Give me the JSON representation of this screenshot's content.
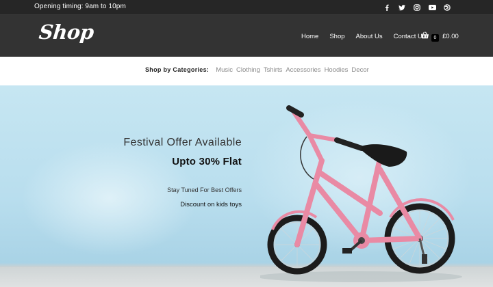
{
  "topbar": {
    "timing": "Opening timing: 9am to 10pm",
    "social": [
      "facebook-icon",
      "twitter-icon",
      "instagram-icon",
      "youtube-icon",
      "dribbble-icon"
    ]
  },
  "header": {
    "logo": "Shop",
    "nav": [
      "Home",
      "Shop",
      "About Us",
      "Contact Us"
    ],
    "cart": {
      "count": "0",
      "total": "£0.00"
    }
  },
  "categories": {
    "title": "Shop by Categories:",
    "items": [
      "Music",
      "Clothing",
      "Tshirts",
      "Accessories",
      "Hoodies",
      "Decor"
    ]
  },
  "hero": {
    "offer": "Festival Offer Available",
    "flat": "Upto 30% Flat",
    "stay": "Stay Tuned For Best Offers",
    "discount": "Discount on kids toys"
  },
  "colors": {
    "topbar": "#262626",
    "header": "#333333",
    "hero_bg": "#bfe2ef",
    "bike_frame": "#e98aa4"
  }
}
